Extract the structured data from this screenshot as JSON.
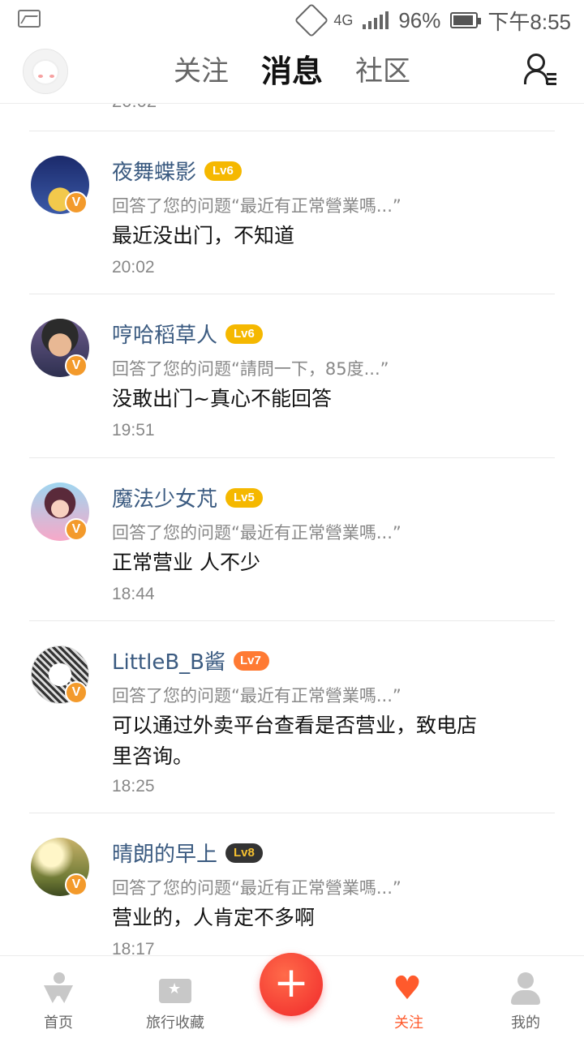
{
  "status_bar": {
    "network": "4G",
    "battery": "96%",
    "time": "下午8:55"
  },
  "top_nav": {
    "tabs": [
      {
        "label": "关注"
      },
      {
        "label": "消息"
      },
      {
        "label": "社区"
      }
    ],
    "active_tab": "消息"
  },
  "feed": {
    "previous_time": "20:02",
    "items": [
      {
        "username": "夜舞蝶影",
        "level": "Lv6",
        "action": "回答了您的问题“最近有正常營業嗎...”",
        "reply": "最近没出门，不知道",
        "time": "20:02"
      },
      {
        "username": "哼哈稻草人",
        "level": "Lv6",
        "action": "回答了您的问题“請問一下，85度...”",
        "reply": "没敢出门~真心不能回答",
        "time": "19:51"
      },
      {
        "username": "魔法少女芃",
        "level": "Lv5",
        "action": "回答了您的问题“最近有正常營業嗎...”",
        "reply": "正常营业 人不少",
        "time": "18:44"
      },
      {
        "username": "LittleB_B酱",
        "level": "Lv7",
        "action": "回答了您的问题“最近有正常營業嗎...”",
        "reply": "可以通过外卖平台查看是否营业，致电店里咨询。",
        "time": "18:25"
      },
      {
        "username": "晴朗的早上",
        "level": "Lv8",
        "action": "回答了您的问题“最近有正常營業嗎...”",
        "reply": "营业的，人肯定不多啊",
        "time": "18:17"
      }
    ],
    "verified_badge": "V"
  },
  "bottom_nav": {
    "items": [
      {
        "label": "首页"
      },
      {
        "label": "旅行收藏"
      },
      {
        "label": "关注"
      },
      {
        "label": "我的"
      }
    ],
    "fab": "+",
    "active_item": "关注",
    "accent_color": "#ff5a2c"
  }
}
